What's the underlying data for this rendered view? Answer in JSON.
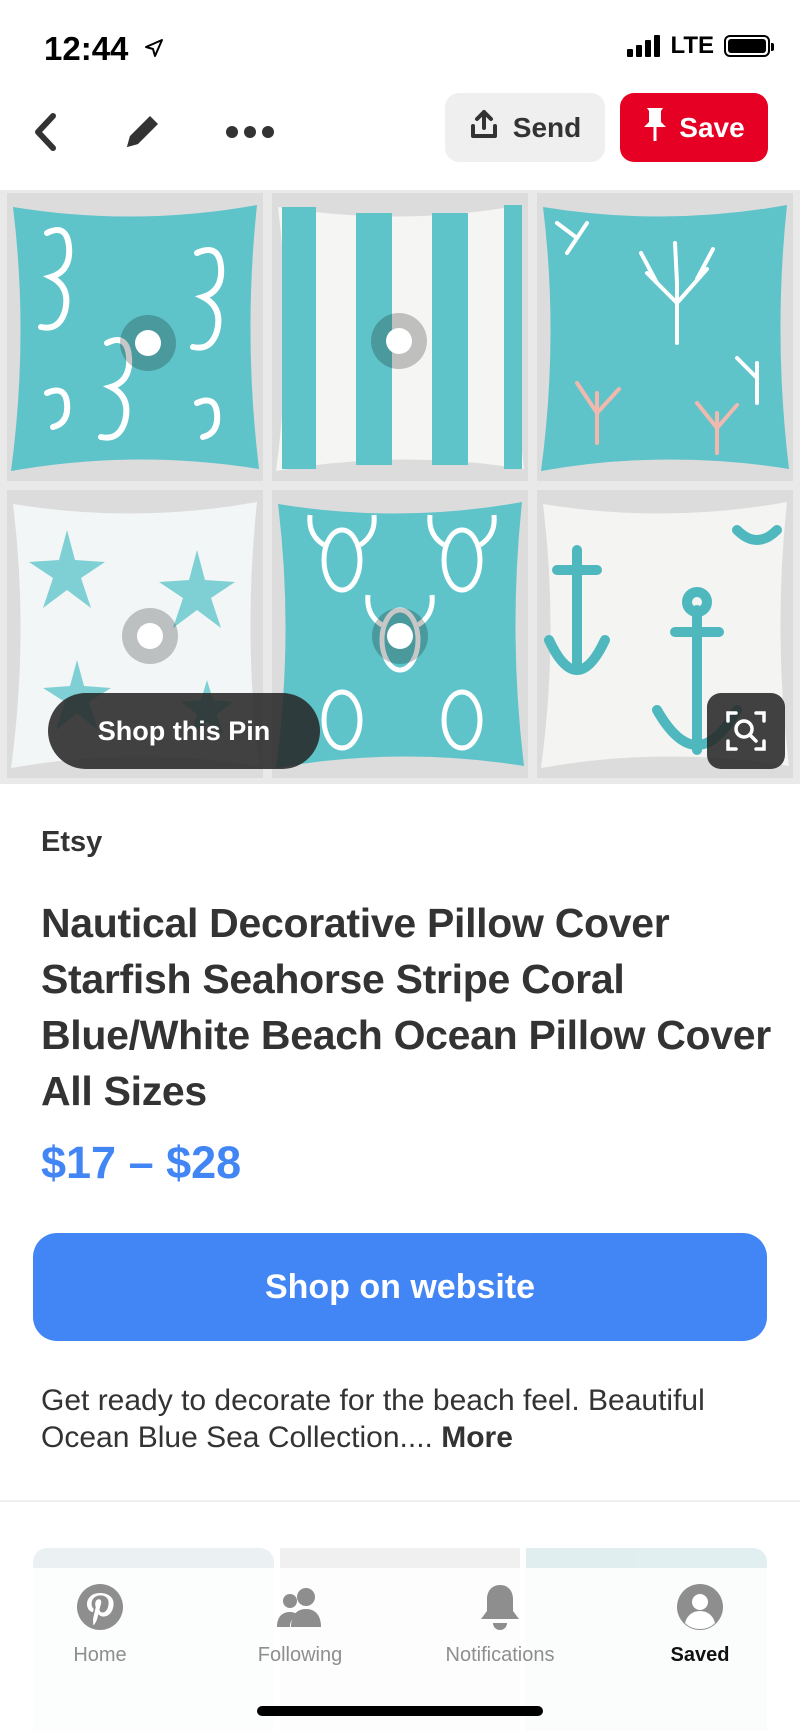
{
  "status_bar": {
    "time": "12:44",
    "network": "LTE",
    "icons": [
      "location-arrow-icon",
      "signal-icon",
      "battery-icon"
    ]
  },
  "top_nav": {
    "icons": [
      "back-chevron-icon",
      "edit-pencil-icon",
      "more-dots-icon"
    ],
    "send_label": "Send",
    "save_label": "Save",
    "save_color": "#e60023"
  },
  "pin_image": {
    "tiles": [
      "seahorse",
      "stripe",
      "coral",
      "starfish",
      "lobster",
      "anchor"
    ],
    "accent_color": "#5ec4ca",
    "shop_pin_label": "Shop this Pin",
    "lens_icon": "visual-search-icon"
  },
  "pin": {
    "source": "Etsy",
    "title": "Nautical Decorative Pillow Cover Starfish Seahorse Stripe Coral Blue/White Beach Ocean Pillow Cover All Sizes",
    "price": "$17 – $28",
    "price_color": "#4285f4",
    "shop_button": "Shop on website",
    "description": "Get ready to decorate for the beach feel. Beautiful Ocean Blue Sea Collection.... ",
    "more_label": "More"
  },
  "tab_bar": {
    "tabs": [
      {
        "label": "Home",
        "icon": "pinterest-logo-icon"
      },
      {
        "label": "Following",
        "icon": "people-icon"
      },
      {
        "label": "Notifications",
        "icon": "bell-icon"
      },
      {
        "label": "Saved",
        "icon": "profile-avatar-icon"
      }
    ],
    "active": "Saved"
  }
}
